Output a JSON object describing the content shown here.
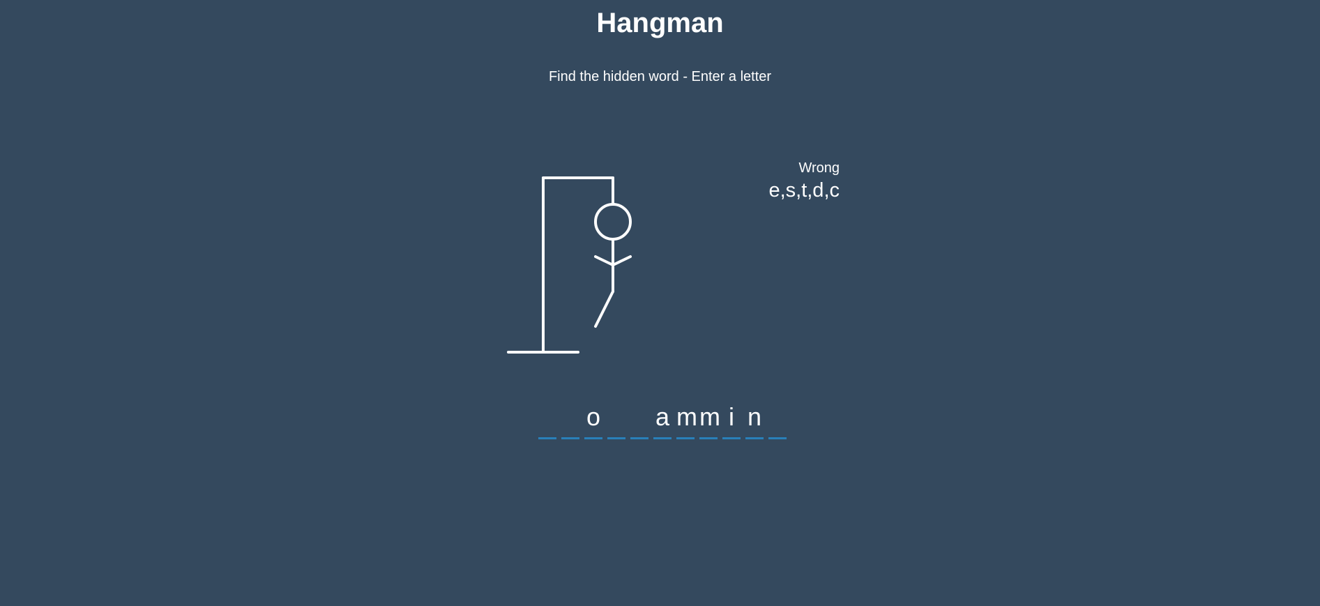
{
  "game": {
    "title": "Hangman",
    "instruction": "Find the hidden word - Enter a letter"
  },
  "wrong_guesses": {
    "label": "Wrong",
    "letters": "e,s,t,d,c"
  },
  "word": {
    "letters": [
      "",
      "",
      "o",
      "",
      "",
      "a",
      "m",
      "m",
      "i",
      "n",
      ""
    ]
  },
  "figure": {
    "parts_visible": [
      "gallows",
      "head",
      "body",
      "left-arm",
      "right-arm",
      "left-leg"
    ],
    "wrong_count": 5
  },
  "colors": {
    "background": "#34495e",
    "text": "#ffffff",
    "underline": "#2980b9"
  }
}
